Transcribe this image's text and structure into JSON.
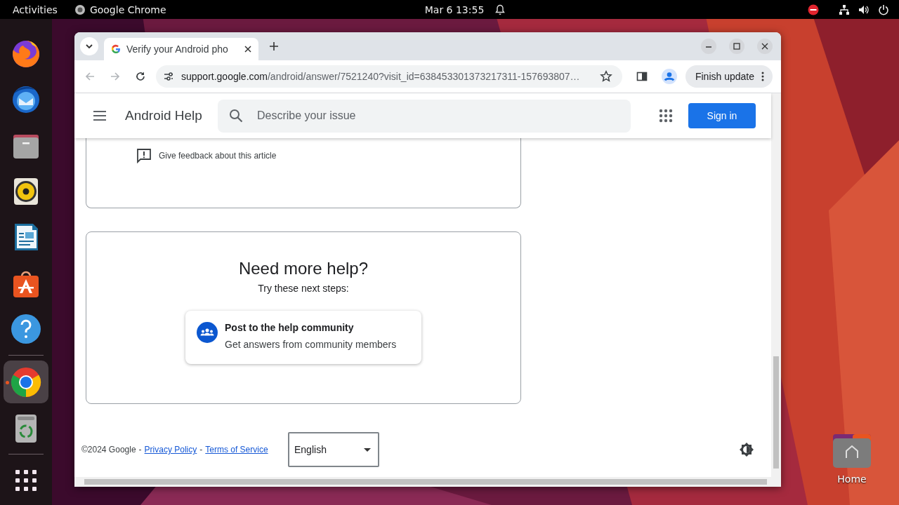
{
  "top_bar": {
    "activities": "Activities",
    "app_name": "Google Chrome",
    "clock": "Mar 6  13:55"
  },
  "dock": {
    "items": [
      {
        "kind": "firefox",
        "selected": false,
        "running": false
      },
      {
        "kind": "mail",
        "selected": false,
        "running": false
      },
      {
        "kind": "files",
        "selected": false,
        "running": false
      },
      {
        "kind": "music",
        "selected": false,
        "running": false
      },
      {
        "kind": "writer",
        "selected": false,
        "running": false
      },
      {
        "kind": "store",
        "selected": false,
        "running": false
      },
      {
        "kind": "help",
        "selected": false,
        "running": false
      },
      {
        "kind": "chrome",
        "selected": true,
        "running": true
      },
      {
        "kind": "trash",
        "selected": false,
        "running": false
      },
      {
        "kind": "apps",
        "selected": false,
        "running": false
      }
    ]
  },
  "desktop": {
    "icons": [
      {
        "label": "Home"
      }
    ]
  },
  "browser": {
    "tabs": [
      {
        "title": "Verify your Android pho",
        "selected": true
      }
    ],
    "toolbar": {
      "back_disabled": true,
      "forward_disabled": true,
      "url_host": "support.google.com",
      "url_path": "/android/answer/7521240?visit_id=638453301373217311-157693807…",
      "update_button": "Finish update"
    },
    "page": {
      "header": {
        "title": "Android Help",
        "search_placeholder": "Describe your issue",
        "sign_in": "Sign in"
      },
      "feedback_link": "Give feedback about this article",
      "help_card": {
        "title": "Need more help?",
        "subtitle": "Try these next steps:",
        "options": [
          {
            "title": "Post to the help community",
            "description": "Get answers from community members"
          }
        ]
      },
      "footer": {
        "items": [
          {
            "kind": "text",
            "text": "©2024 Google"
          },
          {
            "kind": "text",
            "text": "-"
          },
          {
            "kind": "link",
            "text": "Privacy Policy"
          },
          {
            "kind": "text",
            "text": "-"
          },
          {
            "kind": "link",
            "text": "Terms of Service"
          }
        ],
        "language": "English"
      }
    }
  }
}
